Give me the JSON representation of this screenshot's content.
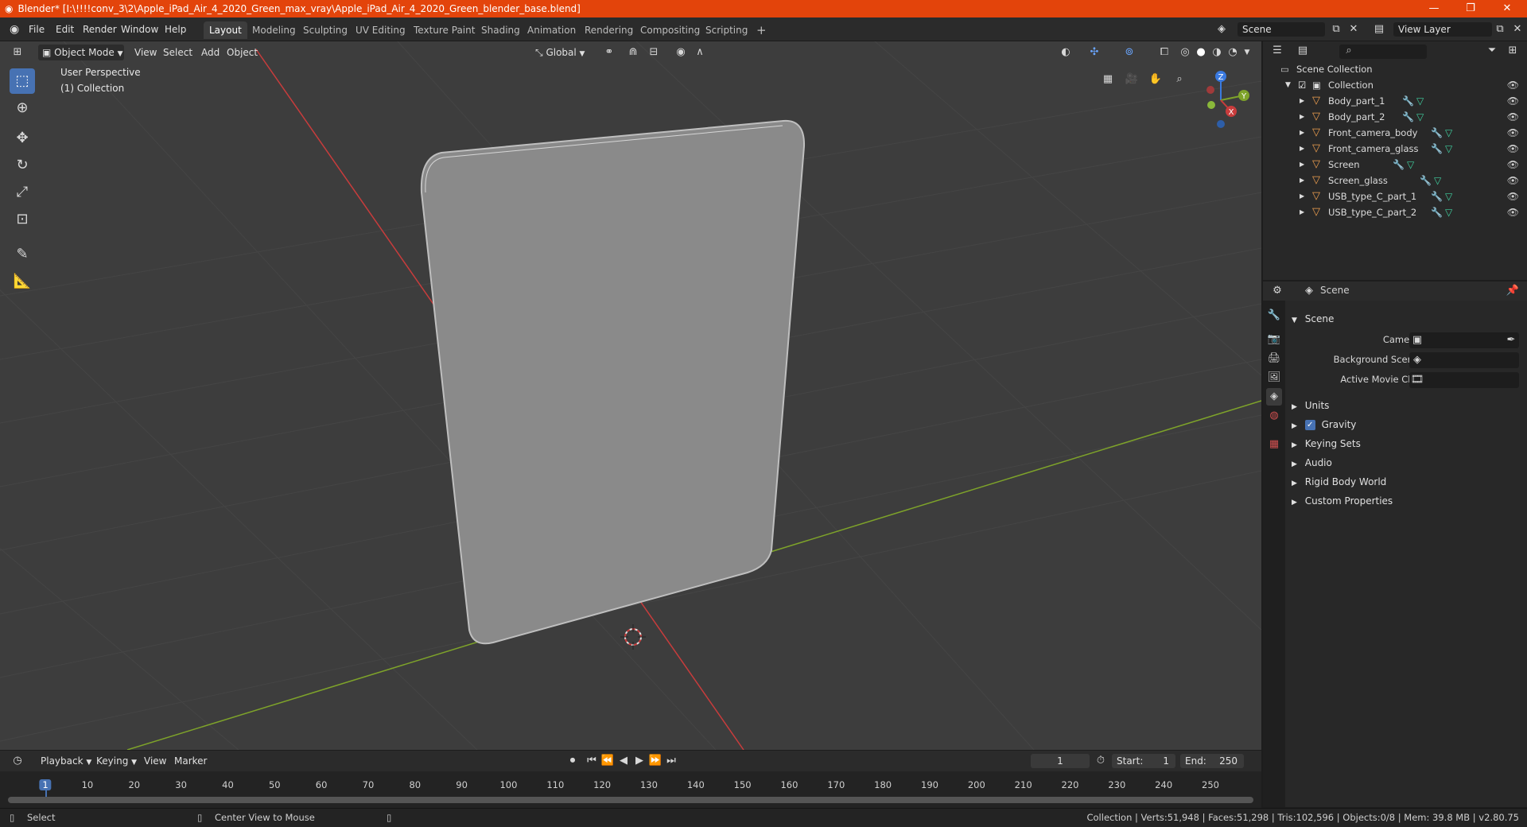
{
  "window": {
    "title": "Blender* [I:\\!!!!conv_3\\2\\Apple_iPad_Air_4_2020_Green_max_vray\\Apple_iPad_Air_4_2020_Green_blender_base.blend]",
    "minimize": "—",
    "maximize": "❐",
    "close": "✕"
  },
  "menu": {
    "items": [
      "File",
      "Edit",
      "Render",
      "Window",
      "Help"
    ],
    "workspaces": [
      "Layout",
      "Modeling",
      "Sculpting",
      "UV Editing",
      "Texture Paint",
      "Shading",
      "Animation",
      "Rendering",
      "Compositing",
      "Scripting"
    ],
    "active_workspace": "Layout",
    "add_workspace": "+",
    "scene": "Scene",
    "view_layer": "View Layer"
  },
  "viewport": {
    "mode": "Object Mode",
    "menus": [
      "View",
      "Select",
      "Add",
      "Object"
    ],
    "orientation": "Global",
    "overlay_line1": "User Perspective",
    "overlay_line2": "(1) Collection",
    "gizmo_axes": [
      "Z",
      "Y",
      "X"
    ]
  },
  "outliner": {
    "search_placeholder": "",
    "root": "Scene Collection",
    "collection": "Collection",
    "objects": [
      "Body_part_1",
      "Body_part_2",
      "Front_camera_body",
      "Front_camera_glass",
      "Screen",
      "Screen_glass",
      "USB_type_C_part_1",
      "USB_type_C_part_2"
    ]
  },
  "properties": {
    "header": "Scene",
    "panel": "Scene",
    "fields": [
      {
        "label": "Camera"
      },
      {
        "label": "Background Scene"
      },
      {
        "label": "Active Movie Clip"
      }
    ],
    "sections": [
      "Units",
      "Gravity",
      "Keying Sets",
      "Audio",
      "Rigid Body World",
      "Custom Properties"
    ],
    "gravity_checked": true
  },
  "timeline": {
    "menus": [
      "Playback",
      "Keying",
      "View",
      "Marker"
    ],
    "current_frame": "1",
    "start_label": "Start:",
    "start": "1",
    "end_label": "End:",
    "end": "250",
    "ticks": [
      "1",
      "10",
      "20",
      "30",
      "40",
      "50",
      "60",
      "70",
      "80",
      "90",
      "100",
      "110",
      "120",
      "130",
      "140",
      "150",
      "160",
      "170",
      "180",
      "190",
      "200",
      "210",
      "220",
      "230",
      "240",
      "250"
    ]
  },
  "status": {
    "select": "Select",
    "center_view": "Center View to Mouse",
    "stats": "Collection | Verts:51,948 | Faces:51,298 | Tris:102,596 | Objects:0/8 | Mem: 39.8 MB | v2.80.75"
  },
  "colors": {
    "titlebar": "#e3440b",
    "accent": "#4772b3",
    "x_axis": "#c83c3c",
    "y_axis": "#7ea32a",
    "z_axis": "#3a7ae0"
  }
}
